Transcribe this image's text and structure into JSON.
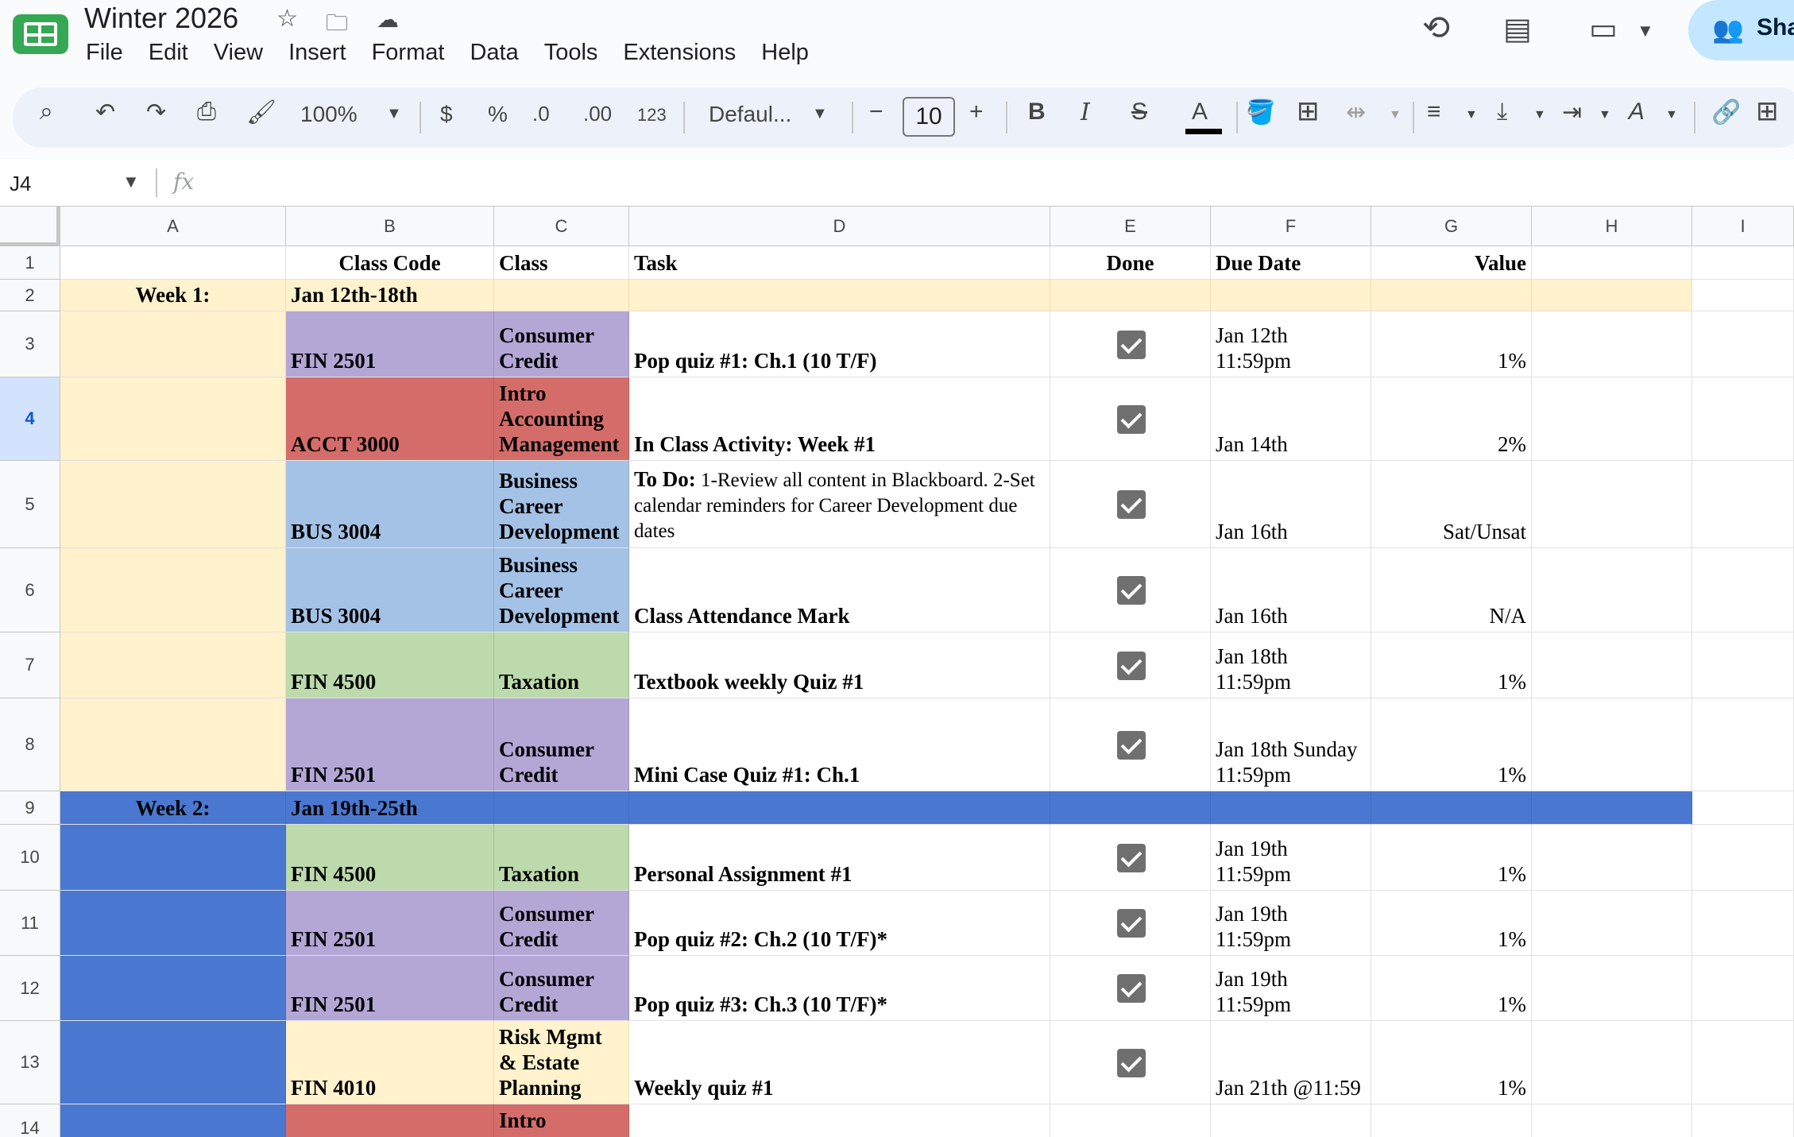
{
  "app": {
    "doc_title": "Winter 2026",
    "menu": [
      "File",
      "Edit",
      "View",
      "Insert",
      "Format",
      "Data",
      "Tools",
      "Extensions",
      "Help"
    ],
    "share_label": "Sha"
  },
  "toolbar": {
    "zoom": "100%",
    "currency": "$",
    "percent": "%",
    "decrease_decimal": ".0",
    "increase_decimal": ".00",
    "number_format": "123",
    "font": "Defaul...",
    "font_size": "10",
    "bold": "B",
    "italic": "I",
    "strikethrough": "S",
    "text_color": "A",
    "text_rotation": "A"
  },
  "formula_bar": {
    "cell_ref": "J4",
    "fx": "fx"
  },
  "columns": [
    "A",
    "B",
    "C",
    "D",
    "E",
    "F",
    "G",
    "H",
    "I"
  ],
  "colors": {
    "week1_yellow": "#fff2cc",
    "week2_blue": "#4a78d0",
    "purple": "#b4a7d6",
    "red": "#d46d6a",
    "light_blue": "#a4c2e6",
    "green": "#bcdaab",
    "light_yellow": "#fff2cc"
  },
  "rows": [
    {
      "num": "1",
      "cells": {
        "B": "Class Code",
        "C": "Class",
        "D": "Task",
        "E": "Done",
        "F": "Due Date",
        "G": "Value"
      }
    },
    {
      "num": "2",
      "cells": {
        "A": "Week 1:",
        "B": "Jan 12th-18th"
      }
    },
    {
      "num": "3",
      "cells": {
        "B": "FIN 2501",
        "C": "Consumer Credit",
        "D": "Pop quiz #1: Ch.1 (10 T/F)",
        "F": "Jan 12th 11:59pm",
        "G": "1%"
      }
    },
    {
      "num": "4",
      "cells": {
        "B": "ACCT 3000",
        "C": "Intro Accounting Management",
        "D": "In Class Activity: Week #1",
        "F": "Jan 14th",
        "G": "2%"
      }
    },
    {
      "num": "5",
      "cells": {
        "B": "BUS 3004",
        "C": "Business Career Development",
        "D_bold": "To Do:",
        "D": " 1-Review all content in Blackboard. 2-Set calendar reminders for Career Development due dates",
        "F": "Jan 16th",
        "G": "Sat/Unsat"
      }
    },
    {
      "num": "6",
      "cells": {
        "B": "BUS 3004",
        "C": "Business Career Development",
        "D": "Class Attendance Mark",
        "F": "Jan 16th",
        "G": "N/A"
      }
    },
    {
      "num": "7",
      "cells": {
        "B": "FIN 4500",
        "C": "Taxation",
        "D": "Textbook weekly Quiz #1",
        "F": "Jan 18th 11:59pm",
        "G": "1%"
      }
    },
    {
      "num": "8",
      "cells": {
        "B": "FIN 2501",
        "C": "Consumer Credit",
        "D": "Mini Case Quiz #1: Ch.1",
        "F": "Jan 18th Sunday 11:59pm",
        "G": "1%"
      }
    },
    {
      "num": "9",
      "cells": {
        "A": "Week 2:",
        "B": "Jan 19th-25th"
      }
    },
    {
      "num": "10",
      "cells": {
        "B": "FIN 4500",
        "C": "Taxation",
        "D": "Personal Assignment #1",
        "F": "Jan 19th 11:59pm",
        "G": "1%"
      }
    },
    {
      "num": "11",
      "cells": {
        "B": "FIN 2501",
        "C": "Consumer Credit",
        "D": "Pop quiz #2: Ch.2 (10 T/F)*",
        "F": "Jan 19th 11:59pm",
        "G": "1%"
      }
    },
    {
      "num": "12",
      "cells": {
        "B": "FIN 2501",
        "C": "Consumer Credit",
        "D": "Pop quiz #3: Ch.3 (10 T/F)*",
        "F": "Jan 19th 11:59pm",
        "G": "1%"
      }
    },
    {
      "num": "13",
      "cells": {
        "B": "FIN 4010",
        "C": "Risk Mgmt & Estate Planning",
        "D": "Weekly quiz #1",
        "F": "Jan 21th @11:59",
        "G": "1%"
      }
    },
    {
      "num": "14",
      "cells": {
        "C": "Intro"
      }
    }
  ]
}
